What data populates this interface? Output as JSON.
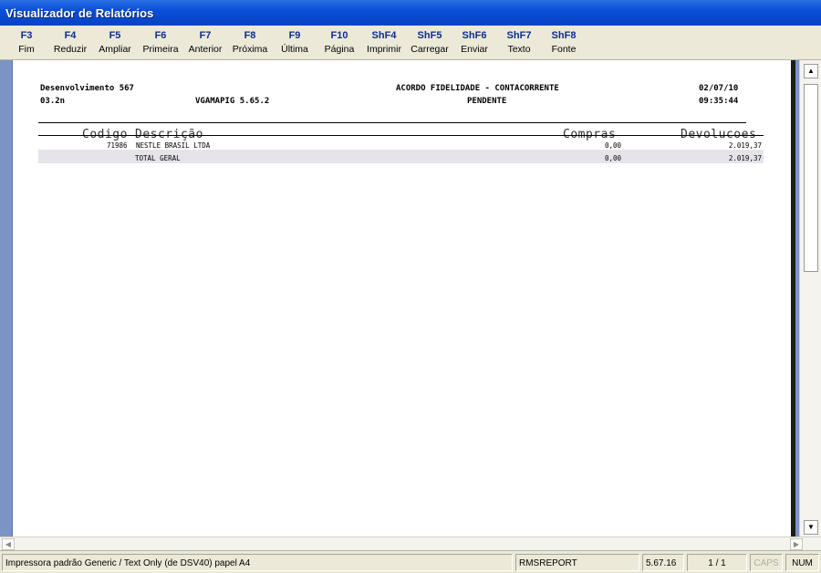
{
  "window": {
    "title": "Visualizador de Relatórios"
  },
  "toolbar": {
    "buttons": [
      {
        "key": "F3",
        "label": "Fim"
      },
      {
        "key": "F4",
        "label": "Reduzir"
      },
      {
        "key": "F5",
        "label": "Ampliar"
      },
      {
        "key": "F6",
        "label": "Primeira"
      },
      {
        "key": "F7",
        "label": "Anterior"
      },
      {
        "key": "F8",
        "label": "Próxima"
      },
      {
        "key": "F9",
        "label": "Última"
      },
      {
        "key": "F10",
        "label": "Página"
      },
      {
        "key": "ShF4",
        "label": "Imprimir"
      },
      {
        "key": "ShF5",
        "label": "Carregar"
      },
      {
        "key": "ShF6",
        "label": "Enviar"
      },
      {
        "key": "ShF7",
        "label": "Texto"
      },
      {
        "key": "ShF8",
        "label": "Fonte"
      }
    ]
  },
  "report": {
    "header": {
      "left_line1": "Desenvolvimento 567",
      "left_line2": "03.2n",
      "program": "VGAMAPIG 5.65.2",
      "title": "ACORDO FIDELIDADE - CONTACORRENTE",
      "status": "PENDENTE",
      "date": "02/07/10",
      "time": "09:35:44"
    },
    "columns": {
      "codigo": "Codigo",
      "descricao": "Descrição",
      "compras": "Compras",
      "devolucoes": "Devolucoes"
    },
    "rows": [
      {
        "codigo": "71986",
        "descricao": "NESTLE BRASIL LTDA",
        "compras": "0,00",
        "devolucoes": "2.019,37"
      }
    ],
    "total": {
      "label": "TOTAL GERAL",
      "compras": "0,00",
      "devolucoes": "2.019,37"
    }
  },
  "statusbar": {
    "printer": "Impressora padrão Generic / Text Only (de DSV40) papel A4",
    "module": "RMSREPORT",
    "version": "5.67.16",
    "pages": "1 / 1",
    "caps": "CAPS",
    "num": "NUM"
  }
}
